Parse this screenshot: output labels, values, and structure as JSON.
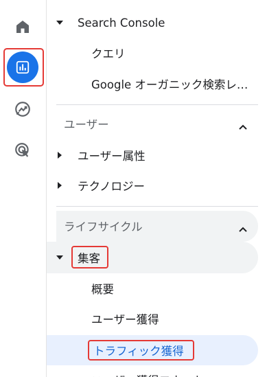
{
  "rail": {
    "items": [
      {
        "name": "home-icon",
        "active": false
      },
      {
        "name": "reports-icon",
        "active": true
      },
      {
        "name": "explore-icon",
        "active": false
      },
      {
        "name": "advertising-icon",
        "active": false
      }
    ],
    "active_color": "#1a73e8"
  },
  "nav": {
    "search_console": {
      "label": "Search Console",
      "items": [
        "クエリ",
        "Google オーガニック検索レ…"
      ]
    },
    "user_section": {
      "label": "ユーザー",
      "items": [
        "ユーザー属性",
        "テクノロジー"
      ]
    },
    "lifecycle_section": {
      "label": "ライフサイクル",
      "group": "集客",
      "items": [
        "概要",
        "ユーザー獲得",
        "トラフィック獲得",
        "ユーザー獲得コホート"
      ]
    }
  },
  "colors": {
    "highlight": "#e53935",
    "selected_bg": "#e8f0fe",
    "selected_text": "#1967d2"
  }
}
